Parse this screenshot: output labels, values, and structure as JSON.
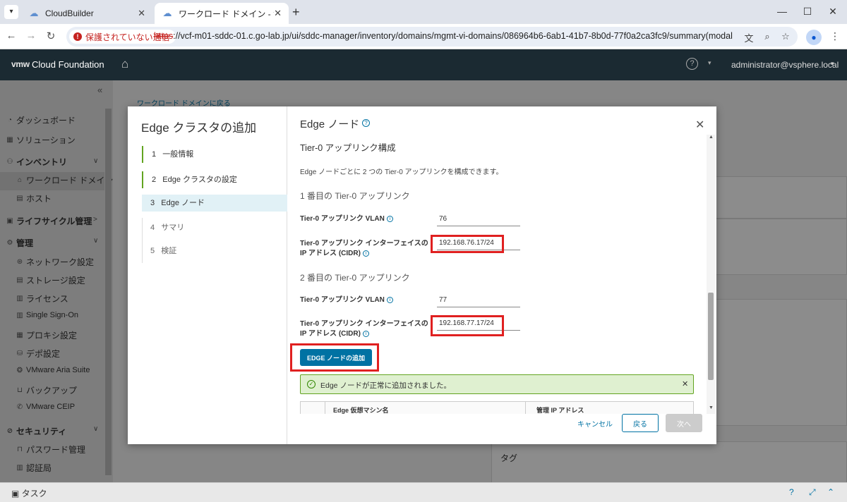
{
  "browser": {
    "tabs": [
      {
        "title": "CloudBuilder",
        "active": false
      },
      {
        "title": "ワークロード ドメイン - サマリ",
        "active": true
      }
    ],
    "security_chip": "保護されていない通信",
    "url_scheme": "https",
    "url_rest": "://vcf-m01-sddc-01.c.go-lab.jp/ui/sddc-manager/inventory/domains/mgmt-vi-domains/086964b6-6ab1-41b7-8b0d-77f0a2ca3fc9/summary(modal:add-edge-c..."
  },
  "app": {
    "logo": "vmw",
    "product": "Cloud Foundation",
    "user": "administrator@vsphere.local"
  },
  "sidebar": {
    "items": [
      {
        "label": "ダッシュボード",
        "icon": "dashboard-icon"
      },
      {
        "label": "ソリューション",
        "icon": "solutions-icon"
      },
      {
        "label": "インベントリ",
        "icon": "inventory-icon"
      },
      {
        "label": "ワークロード ドメイン",
        "icon": "workload-icon"
      },
      {
        "label": "ホスト",
        "icon": "host-icon"
      },
      {
        "label": "ライフサイクル管理",
        "icon": "lifecycle-icon"
      },
      {
        "label": "管理",
        "icon": "admin-icon"
      },
      {
        "label": "ネットワーク設定",
        "icon": "network-icon"
      },
      {
        "label": "ストレージ設定",
        "icon": "storage-icon"
      },
      {
        "label": "ライセンス",
        "icon": "license-icon"
      },
      {
        "label": "Single Sign-On",
        "icon": "sso-icon"
      },
      {
        "label": "プロキシ設定",
        "icon": "proxy-icon"
      },
      {
        "label": "デポ設定",
        "icon": "depot-icon"
      },
      {
        "label": "VMware Aria Suite",
        "icon": "aria-icon"
      },
      {
        "label": "バックアップ",
        "icon": "backup-icon"
      },
      {
        "label": "VMware CEIP",
        "icon": "ceip-icon"
      },
      {
        "label": "セキュリティ",
        "icon": "security-icon"
      },
      {
        "label": "パスワード管理",
        "icon": "password-icon"
      },
      {
        "label": "認証局",
        "icon": "cert-icon"
      }
    ]
  },
  "background": {
    "breadcrumb": "ワークロード ドメインに戻る",
    "name_fragment": "名",
    "tag_label": "タグ",
    "task_label": "タスク"
  },
  "wizard": {
    "title": "Edge クラスタの追加",
    "steps": [
      {
        "num": "1",
        "label": "一般情報"
      },
      {
        "num": "2",
        "label": "Edge クラスタの設定"
      },
      {
        "num": "3",
        "label": "Edge ノード"
      },
      {
        "num": "4",
        "label": "サマリ"
      },
      {
        "num": "5",
        "label": "検証"
      }
    ],
    "page_title": "Edge ノード",
    "section_title": "Tier-0 アップリンク構成",
    "section_desc": "Edge ノードごとに 2 つの Tier-0 アップリンクを構成できます。",
    "uplink1": {
      "heading": "1 番目の Tier-0 アップリンク",
      "vlan_label": "Tier-0 アップリンク VLAN",
      "vlan_value": "76",
      "ip_label_1": "Tier-0 アップリンク インターフェイスの",
      "ip_label_2": "IP アドレス (CIDR)",
      "ip_value": "192.168.76.17/24"
    },
    "uplink2": {
      "heading": "2 番目の Tier-0 アップリンク",
      "vlan_label": "Tier-0 アップリンク VLAN",
      "vlan_value": "77",
      "ip_label_1": "Tier-0 アップリンク インターフェイスの",
      "ip_label_2": "IP アドレス (CIDR)",
      "ip_value": "192.168.77.17/24"
    },
    "add_button": "EDGE ノードの追加",
    "alert_text": "Edge ノードが正常に追加されました。",
    "grid_columns": [
      "Edge 仮想マシン名",
      "管理 IP アドレス"
    ],
    "buttons": {
      "cancel": "キャンセル",
      "back": "戻る",
      "next": "次へ"
    }
  },
  "colors": {
    "accent": "#0072a3",
    "highlight": "#e02020",
    "success": "#62a420"
  }
}
